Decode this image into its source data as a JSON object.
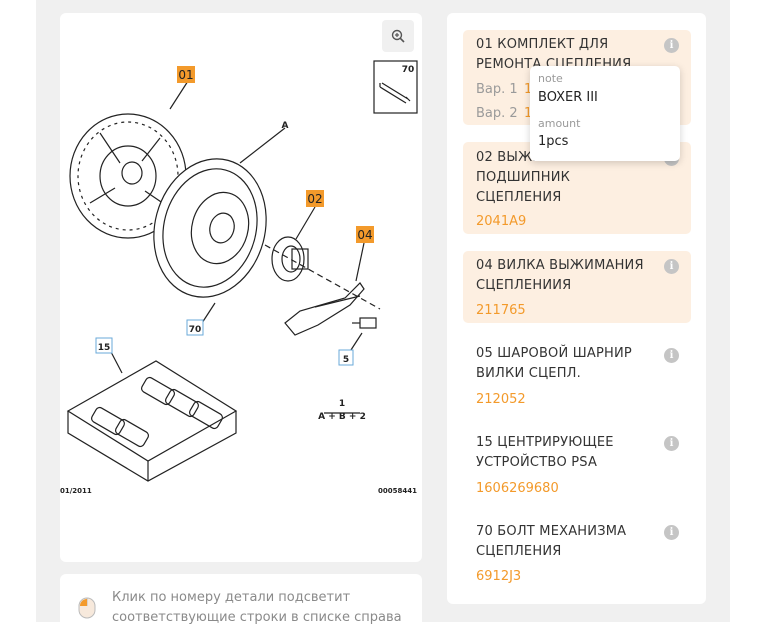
{
  "diagram": {
    "callouts": {
      "c01": "01",
      "c02": "02",
      "c04": "04",
      "c70_top": "70",
      "c70": "70",
      "c15": "15",
      "c5": "5"
    },
    "letter_a": "A",
    "formula_top": "1",
    "formula_bottom": "A + B + 2",
    "footer_left": "01/2011",
    "footer_right": "00058441",
    "highlight_color": "#f39a2b"
  },
  "hint": {
    "icon": "mouse-icon",
    "text": "Клик по номеру детали подсветит соответствующие строки в списке справа"
  },
  "parts": [
    {
      "title": "01 КОМПЛЕКТ ДЛЯ РЕМОНТА СЦЕПЛЕНИЯ",
      "variants": [
        {
          "label": "Вар. 1",
          "code": "1("
        },
        {
          "label": "Вар. 2",
          "code": "1("
        }
      ],
      "highlighted": true
    },
    {
      "title": "02 ВЫЖИМНОЙ ПОДШИПНИК СЦЕПЛЕНИЯ",
      "code": "2041A9",
      "highlighted": true
    },
    {
      "title": "04 ВИЛКА ВЫЖИМАНИЯ СЦЕПЛЕНИИЯ",
      "code": "211765",
      "highlighted": true
    },
    {
      "title": "05 ШАРОВОЙ ШАРНИР ВИЛКИ СЦЕПЛ.",
      "code": "212052",
      "highlighted": false
    },
    {
      "title": "15 ЦЕНТРИРУЮЩЕЕ УСТРОЙСТВО PSA",
      "code": "1606269680",
      "highlighted": false
    },
    {
      "title": "70 БОЛТ МЕХАНИЗМА СЦЕПЛЕНИЯ",
      "code": "6912J3",
      "highlighted": false
    }
  ],
  "tooltip": {
    "note_label": "note",
    "note_value": "BOXER III",
    "amount_label": "amount",
    "amount_value": "1pcs"
  }
}
